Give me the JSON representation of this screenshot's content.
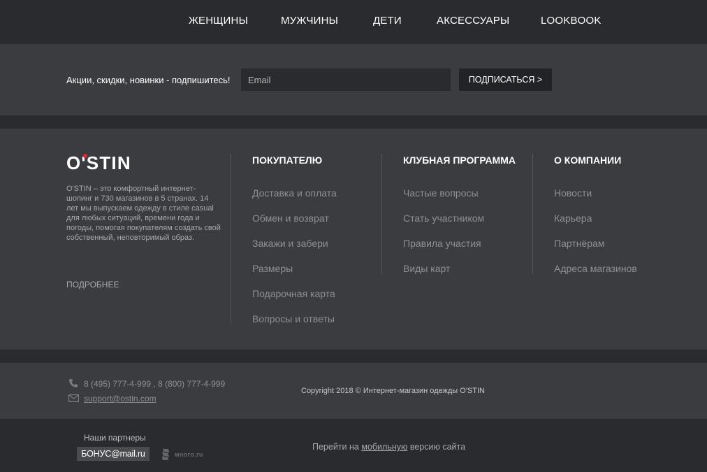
{
  "nav": {
    "items": [
      "ЖЕНЩИНЫ",
      "МУЖЧИНЫ",
      "ДЕТИ",
      "АКСЕССУАРЫ",
      "LOOKBOOK"
    ]
  },
  "subscribe": {
    "label": "Акции, скидки, новинки - подпишитесь!",
    "placeholder": "Email",
    "button": "ПОДПИСАТЬСЯ >"
  },
  "brand": {
    "logo": "O'STIN",
    "about": "O'STIN – это комфортный интернет-шопинг и 730 магазинов в 5 странах. 14 лет мы выпускаем одежду в стиле casual для любых ситуаций, времени года и погоды, помогая покупателям создать свой собственный, неповторимый образ.",
    "more": "ПОДРОБНЕЕ",
    "accent": "#e3262f"
  },
  "columns": [
    {
      "title": "ПОКУПАТЕЛЮ",
      "links": [
        "Доставка и оплата",
        "Обмен и возврат",
        "Закажи и забери",
        "Размеры",
        "Подарочная карта",
        "Вопросы и ответы"
      ]
    },
    {
      "title": "КЛУБНАЯ ПРОГРАММА",
      "links": [
        "Частые вопросы",
        "Стать участником",
        "Правила участия",
        "Виды карт"
      ]
    },
    {
      "title": "О КОМПАНИИ",
      "links": [
        "Новости",
        "Карьера",
        "Партнёрам",
        "Адреса магазинов"
      ]
    }
  ],
  "contacts": {
    "phone_icon": "phone-icon",
    "phones": "8 (495) 777-4-999 , 8 (800) 777-4-999",
    "mail_icon": "envelope-icon",
    "email": "support@ostin.com",
    "copyright": "Copyright 2018 © Интернет-магазин одежды O'STIN"
  },
  "partners": {
    "label": "Наши партнеры",
    "bonus": "БОНУС@mail.ru",
    "mnogo": "много.ru"
  },
  "mobile": {
    "prefix": "Перейти на ",
    "link": "мобильную",
    "suffix": " версию сайта"
  }
}
